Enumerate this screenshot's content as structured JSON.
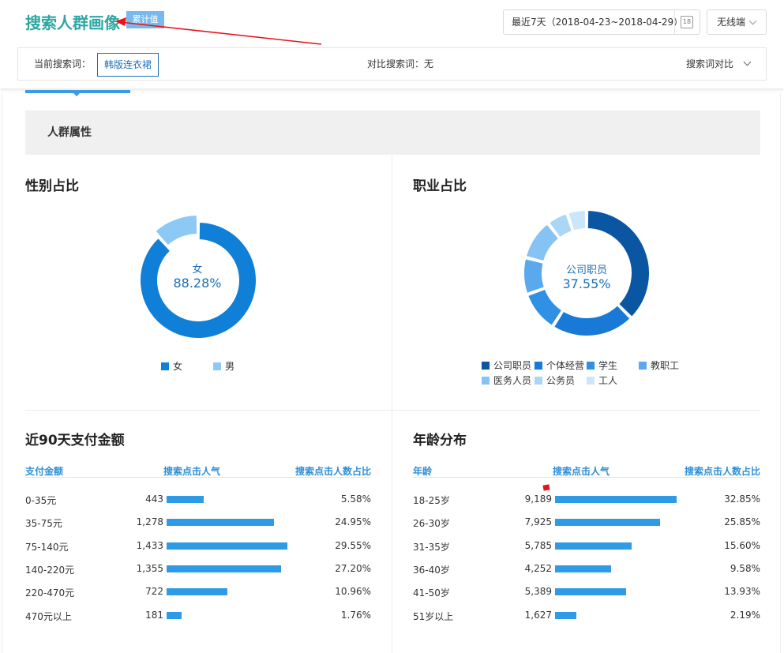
{
  "header": {
    "title": "搜索人群画像",
    "tag": "累计值",
    "date_range": "最近7天（2018-04-23~2018-04-29）",
    "calendar_icon": "calendar-icon",
    "device": "无线端"
  },
  "search_bar": {
    "current_label": "当前搜索词：",
    "current_term": "韩版连衣裙",
    "compare_label": "对比搜索词：无",
    "compare_toggle": "搜索词对比"
  },
  "section": {
    "title": "人群属性"
  },
  "gender": {
    "title": "性别占比",
    "center_name": "女",
    "center_value": "88.28%",
    "legend": [
      {
        "name": "女",
        "color": "#0f7fd8"
      },
      {
        "name": "男",
        "color": "#8ccaf5"
      }
    ]
  },
  "occupation": {
    "title": "职业占比",
    "center_name": "公司职员",
    "center_value": "37.55%",
    "legend": [
      {
        "name": "公司职员",
        "color": "#0a56a3"
      },
      {
        "name": "个体经营",
        "color": "#1879d6"
      },
      {
        "name": "学生",
        "color": "#2f90e4"
      },
      {
        "name": "教职工",
        "color": "#5aa9ef"
      },
      {
        "name": "医务人员",
        "color": "#86c2f3"
      },
      {
        "name": "公务员",
        "color": "#aad6f7"
      },
      {
        "name": "工人",
        "color": "#cbe6fa"
      }
    ]
  },
  "payment": {
    "title": "近90天支付金额",
    "col1": "支付金额",
    "col2": "搜索点击人气",
    "col3": "搜索点击人数占比",
    "rows": [
      {
        "label": "0-35元",
        "value": "443",
        "share": "5.58%"
      },
      {
        "label": "35-75元",
        "value": "1,278",
        "share": "24.95%"
      },
      {
        "label": "75-140元",
        "value": "1,433",
        "share": "29.55%"
      },
      {
        "label": "140-220元",
        "value": "1,355",
        "share": "27.20%"
      },
      {
        "label": "220-470元",
        "value": "722",
        "share": "10.96%"
      },
      {
        "label": "470元以上",
        "value": "181",
        "share": "1.76%"
      }
    ]
  },
  "age": {
    "title": "年龄分布",
    "col1": "年龄",
    "col2": "搜索点击人气",
    "col3": "搜索点击人数占比",
    "rows": [
      {
        "label": "18-25岁",
        "value": "9,189",
        "share": "32.85%"
      },
      {
        "label": "26-30岁",
        "value": "7,925",
        "share": "25.85%"
      },
      {
        "label": "31-35岁",
        "value": "5,785",
        "share": "15.60%"
      },
      {
        "label": "36-40岁",
        "value": "4,252",
        "share": "9.58%"
      },
      {
        "label": "41-50岁",
        "value": "5,389",
        "share": "13.93%"
      },
      {
        "label": "51岁以上",
        "value": "1,627",
        "share": "2.19%"
      }
    ]
  },
  "chart_data": [
    {
      "type": "pie",
      "title": "性别占比",
      "categories": [
        "女",
        "男"
      ],
      "values": [
        88.28,
        11.72
      ]
    },
    {
      "type": "pie",
      "title": "职业占比",
      "categories": [
        "公司职员",
        "个体经营",
        "学生",
        "教职工",
        "医务人员",
        "公务员",
        "工人"
      ],
      "values": [
        37.55,
        21.5,
        10.5,
        9.5,
        10.5,
        5.5,
        5.0
      ]
    },
    {
      "type": "bar",
      "title": "近90天支付金额",
      "categories": [
        "0-35元",
        "35-75元",
        "75-140元",
        "140-220元",
        "220-470元",
        "470元以上"
      ],
      "values": [
        443,
        1278,
        1433,
        1355,
        722,
        181
      ],
      "max": 1433
    },
    {
      "type": "bar",
      "title": "年龄分布",
      "categories": [
        "18-25岁",
        "26-30岁",
        "31-35岁",
        "36-40岁",
        "41-50岁",
        "51岁以上"
      ],
      "values": [
        9189,
        7925,
        5785,
        4252,
        5389,
        1627
      ],
      "max": 9189
    }
  ]
}
